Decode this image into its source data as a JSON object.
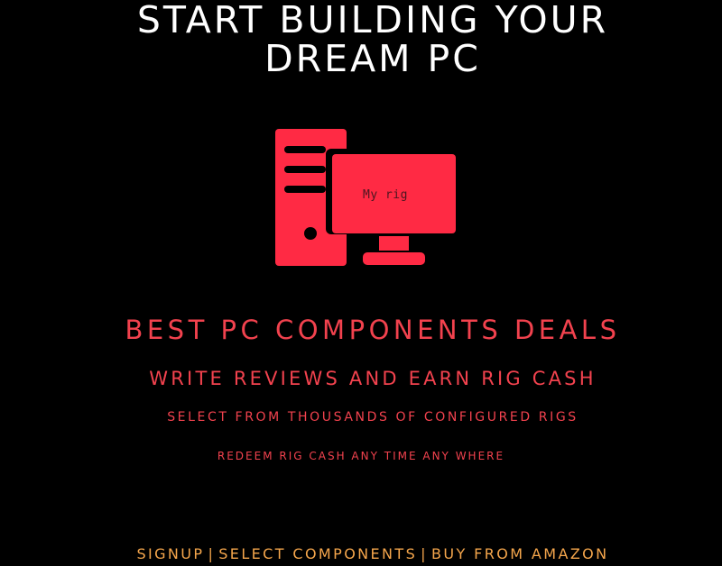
{
  "hero": {
    "headline_line1": "START BUILDING YOUR",
    "headline_line2": "DREAM PC",
    "monitor_label": "My rig"
  },
  "taglines": {
    "deals": "BEST PC COMPONENTS DEALS",
    "reviews": "WRITE REVIEWS AND EARN RIG CASH",
    "select": "SELECT FROM THOUSANDS OF CONFIGURED RIGS",
    "redeem": "REDEEM RIG CASH ANY TIME ANY WHERE"
  },
  "footer_nav": {
    "signup": "SIGNUP",
    "select_components": "SELECT COMPONENTS",
    "buy_amazon": "BUY FROM AMAZON",
    "separator": "|"
  },
  "colors": {
    "background": "#000000",
    "accent_red": "#ff2a44",
    "text_red": "#f2424e",
    "footer_orange": "#f5a64c"
  },
  "icons": {
    "illustration": "desktop-pc-icon"
  }
}
